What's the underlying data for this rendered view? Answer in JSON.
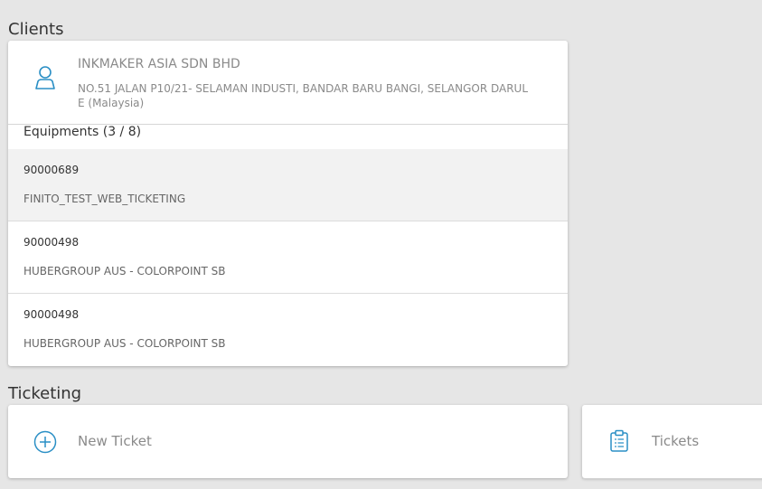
{
  "clients": {
    "section_title": "Clients",
    "client": {
      "name": "INKMAKER ASIA SDN BHD",
      "address": "NO.51 JALAN P10/21- SELAMAN INDUSTI, BANDAR BARU BANGI, SELANGOR DARUL E (Malaysia)",
      "icon": "user-icon"
    },
    "equipments_header": "Equipments (3 / 8)",
    "equipments": [
      {
        "id": "90000689",
        "name": "FINITO_TEST_WEB_TICKETING",
        "selected": true
      },
      {
        "id": "90000498",
        "name": "HUBERGROUP AUS - COLORPOINT SB",
        "selected": false
      },
      {
        "id": "90000498",
        "name": "HUBERGROUP AUS - COLORPOINT SB",
        "selected": false
      }
    ]
  },
  "ticketing": {
    "section_title": "Ticketing",
    "new_ticket_label": "New Ticket",
    "new_ticket_icon": "plus-circle-icon",
    "tickets_label": "Tickets",
    "tickets_icon": "clipboard-icon"
  },
  "colors": {
    "accent": "#2a8fc5",
    "background": "#e6e6e6",
    "selected_row": "#f2f2f2"
  }
}
